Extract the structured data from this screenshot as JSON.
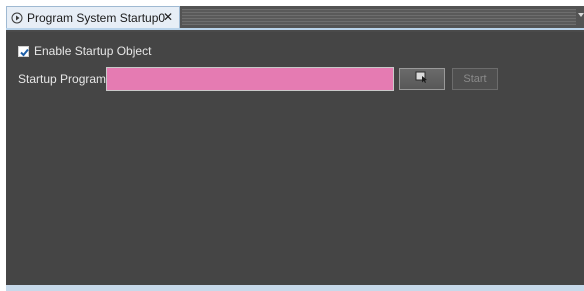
{
  "tab": {
    "title": "Program System Startup0",
    "icon": "play-circle-icon",
    "close_glyph": "✕"
  },
  "settings": {
    "enable_startup_object": {
      "label": "Enable Startup Object",
      "checked": true
    },
    "startup_program": {
      "label": "Startup Program",
      "value": "",
      "placeholder": ""
    }
  },
  "buttons": {
    "browse_icon": "cursor-select-icon",
    "start_label": "Start",
    "start_enabled": false
  },
  "colors": {
    "window_bg": "#454545",
    "input_highlight": "#e57bb2",
    "tab_bg": "#e7eef6",
    "accent_border": "#b9d3ea"
  }
}
